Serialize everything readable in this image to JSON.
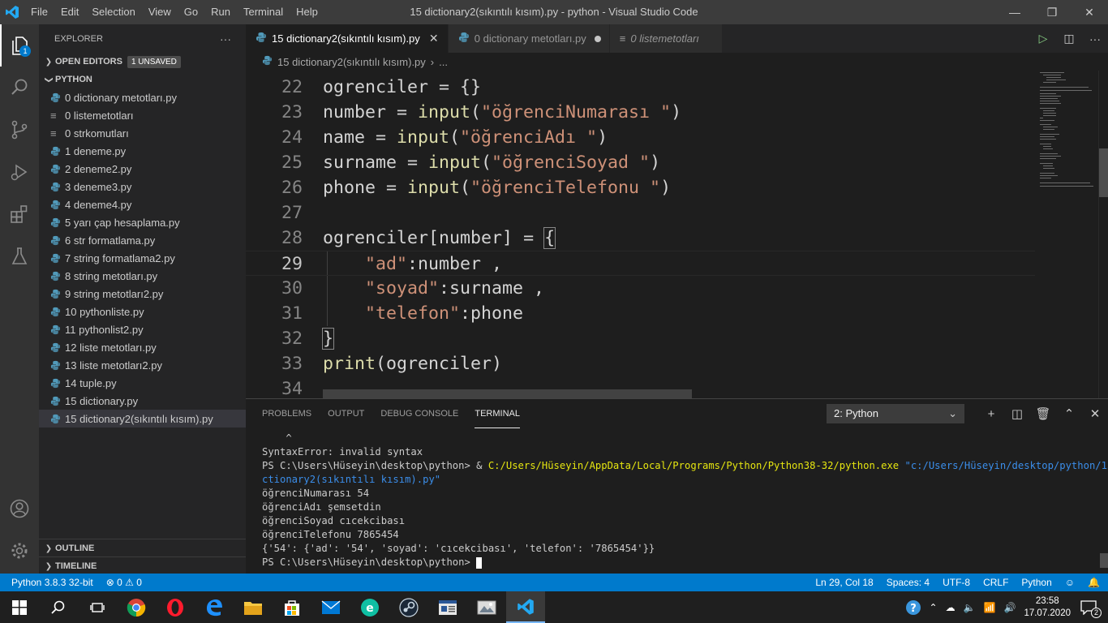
{
  "titlebar": {
    "window_title": "15 dictionary2(sıkıntılı kısım).py - python - Visual Studio Code",
    "menu": [
      "File",
      "Edit",
      "Selection",
      "View",
      "Go",
      "Run",
      "Terminal",
      "Help"
    ]
  },
  "activitybar": {
    "items": [
      "explorer-icon",
      "search-icon",
      "source-control-icon",
      "run-debug-icon",
      "extensions-icon",
      "testing-icon"
    ],
    "explorer_badge": "1",
    "bottom": [
      "account-icon",
      "manage-gear-icon"
    ]
  },
  "sidebar": {
    "title": "EXPLORER",
    "more": "···",
    "open_editors": "OPEN EDITORS",
    "unsaved_badge": "1 UNSAVED",
    "folder": "PYTHON",
    "files": [
      {
        "name": "0 dictionary metotları.py",
        "type": "py"
      },
      {
        "name": "0 listemetotları",
        "type": "txt"
      },
      {
        "name": "0 strkomutları",
        "type": "txt"
      },
      {
        "name": "1 deneme.py",
        "type": "py"
      },
      {
        "name": "2 deneme2.py",
        "type": "py"
      },
      {
        "name": "3 deneme3.py",
        "type": "py"
      },
      {
        "name": "4 deneme4.py",
        "type": "py"
      },
      {
        "name": "5 yarı çap hesaplama.py",
        "type": "py"
      },
      {
        "name": "6 str formatlama.py",
        "type": "py"
      },
      {
        "name": "7 string formatlama2.py",
        "type": "py"
      },
      {
        "name": "8 string metotları.py",
        "type": "py"
      },
      {
        "name": "9 string metotları2.py",
        "type": "py"
      },
      {
        "name": "10 pythonliste.py",
        "type": "py"
      },
      {
        "name": "11 pythonlist2.py",
        "type": "py"
      },
      {
        "name": "12 liste metotları.py",
        "type": "py"
      },
      {
        "name": "13 liste metotları2.py",
        "type": "py"
      },
      {
        "name": "14 tuple.py",
        "type": "py"
      },
      {
        "name": "15 dictionary.py",
        "type": "py"
      },
      {
        "name": "15 dictionary2(sıkıntılı kısım).py",
        "type": "py",
        "selected": true
      }
    ],
    "outline": "OUTLINE",
    "timeline": "TIMELINE"
  },
  "tabs": [
    {
      "label": "15 dictionary2(sıkıntılı kısım).py",
      "active": true,
      "state": "close"
    },
    {
      "label": "0 dictionary metotları.py",
      "active": false,
      "state": "dirty"
    },
    {
      "label": "0 listemetotları",
      "active": false,
      "state": "none",
      "italic": true
    }
  ],
  "breadcrumb": {
    "file": "15 dictionary2(sıkıntılı kısım).py",
    "rest": "..."
  },
  "code": {
    "lines": [
      {
        "n": "22",
        "text": "ogrenciler = {}"
      },
      {
        "n": "23",
        "text": "number = input(\"öğrenciNumarası \")"
      },
      {
        "n": "24",
        "text": "name = input(\"öğrenciAdı \")"
      },
      {
        "n": "25",
        "text": "surname = input(\"öğrenciSoyad \")"
      },
      {
        "n": "26",
        "text": "phone = input(\"öğrenciTelefonu \")"
      },
      {
        "n": "27",
        "text": ""
      },
      {
        "n": "28",
        "text": "ogrenciler[number] = {"
      },
      {
        "n": "29",
        "text": "    \"ad\":number ,"
      },
      {
        "n": "30",
        "text": "    \"soyad\":surname ,"
      },
      {
        "n": "31",
        "text": "    \"telefon\":phone"
      },
      {
        "n": "32",
        "text": "}"
      },
      {
        "n": "33",
        "text": "print(ogrenciler)"
      },
      {
        "n": "34",
        "text": ""
      }
    ]
  },
  "panel": {
    "tabs": [
      "PROBLEMS",
      "OUTPUT",
      "DEBUG CONSOLE",
      "TERMINAL"
    ],
    "active_tab": "TERMINAL",
    "terminal_select": "2: Python",
    "terminal": {
      "caret": "    ^",
      "error": "SyntaxError: invalid syntax",
      "prompt": "PS C:\\Users\\Hüseyin\\desktop\\python> ",
      "amp": "& ",
      "exe": "C:/Users/Hüseyin/AppData/Local/Programs/Python/Python38-32/python.exe",
      "arg1": "\"c:/Users/Hüseyin/desktop/python/15 di",
      "arg2": "ctionary2(sıkıntılı kısım).py\"",
      "out1": "öğrenciNumarası 54",
      "out2": "öğrenciAdı şemsetdin",
      "out3": "öğrenciSoyad cıcekcibası",
      "out4": "öğrenciTelefonu 7865454",
      "out5": "{'54': {'ad': '54', 'soyad': 'cıcekcibası', 'telefon': '7865454'}}",
      "final_prompt": "PS C:\\Users\\Hüseyin\\desktop\\python> "
    }
  },
  "statusbar": {
    "interpreter": "Python 3.8.3 32-bit",
    "problems": "⊗ 0 ⚠ 0",
    "position": "Ln 29, Col 18",
    "spaces": "Spaces: 4",
    "encoding": "UTF-8",
    "eol": "CRLF",
    "language": "Python"
  },
  "taskbar": {
    "time": "23:58",
    "date": "17.07.2020",
    "notifications": "2"
  },
  "colors": {
    "accent": "#007acc",
    "string": "#ce9178",
    "function": "#dcdcaa",
    "terminal_path": "#e5e510",
    "terminal_string": "#3b8eea"
  }
}
